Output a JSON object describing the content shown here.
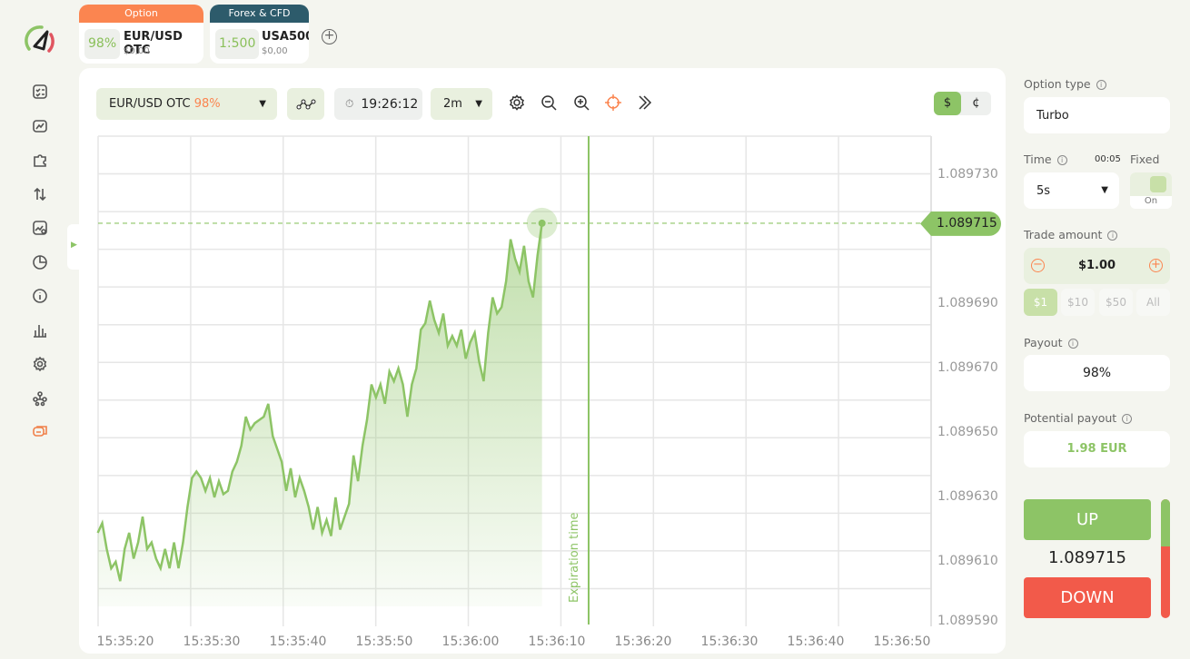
{
  "tabs": [
    {
      "category": "Option",
      "category_color": "#fb8550",
      "badge": "98%",
      "asset": "EUR/USD OTC",
      "balance": "$0,00"
    },
    {
      "category": "Forex & CFD",
      "category_color": "#2d5b6b",
      "badge": "1:500",
      "asset": "USA500",
      "balance": "$0,00"
    }
  ],
  "add_tab_icon": "plus-circle-icon",
  "sidebar": {
    "icons": [
      "checklist-icon",
      "trade-icon",
      "puzzle-icon",
      "sort-arrows-icon",
      "chart-settings-icon",
      "pie-chart-icon",
      "info-icon",
      "bar-chart-icon",
      "gear-icon",
      "network-icon",
      "chat-icon"
    ],
    "active": "chat-icon"
  },
  "toolbar": {
    "asset": "EUR/USD OTC",
    "asset_payout": "98%",
    "clock": "19:26:12",
    "timeframe": "2m",
    "currency_options": [
      "$",
      "¢"
    ],
    "currency_selected": "$",
    "tools": [
      "gear-icon",
      "zoom-out-icon",
      "zoom-in-icon",
      "crosshair-icon",
      "double-chevron-right-icon"
    ]
  },
  "chart": {
    "expiration_label": "Expiration time",
    "current_price": "1.089715"
  },
  "chart_data": {
    "type": "area",
    "x_start": "15:35:16.8",
    "x_interval_seconds": 0.52,
    "values": [
      619,
      622,
      614,
      608,
      610,
      604,
      614,
      619,
      611,
      616,
      624,
      614,
      616,
      611,
      608,
      614,
      608,
      616,
      608,
      616,
      627,
      636,
      638,
      636,
      632,
      636,
      630,
      635,
      631,
      632,
      638,
      641,
      646,
      655,
      651,
      653,
      654,
      655,
      659,
      649,
      645,
      641,
      632,
      639,
      630,
      636,
      632,
      627,
      620,
      627,
      619,
      623,
      618,
      630,
      620,
      624,
      628,
      643,
      635,
      646,
      654,
      665,
      661,
      665,
      659,
      669,
      666,
      670,
      665,
      655,
      665,
      670,
      682,
      684,
      691,
      685,
      681,
      687,
      677,
      680,
      677,
      682,
      673,
      678,
      681,
      672,
      666,
      681,
      692,
      687,
      689,
      697,
      710,
      704,
      700,
      708,
      697,
      692,
      705,
      715
    ],
    "value_prefix": "1.089",
    "y_ticks": [
      "1.089730",
      "1.089690",
      "1.089670",
      "1.089650",
      "1.089630",
      "1.089610",
      "1.089590"
    ],
    "x_ticks": [
      "15:35:20",
      "15:35:30",
      "15:35:40",
      "15:35:50",
      "15:36:00",
      "15:36:10",
      "15:36:20",
      "15:36:30",
      "15:36:40",
      "15:36:50"
    ],
    "ylim": [
      1.08959,
      1.089742
    ],
    "grid": true,
    "color": "#8dc466"
  },
  "panel": {
    "option_type_label": "Option type",
    "option_type": "Turbo",
    "time_label": "Time",
    "time_countdown": "00:05",
    "time_value": "5s",
    "fixed_label": "Fixed",
    "fixed_state": "On",
    "trade_amount_label": "Trade amount",
    "trade_amount": "$1.00",
    "quick_amounts": [
      "$1",
      "$10",
      "$50",
      "All"
    ],
    "quick_selected": "$1",
    "payout_label": "Payout",
    "payout": "98%",
    "potential_label": "Potential payout",
    "potential": "1.98 EUR",
    "up_label": "UP",
    "down_label": "DOWN",
    "price": "1.089715",
    "sentiment_up_percent": 40,
    "up_color": "#8dc466",
    "down_color": "#f25a4a"
  }
}
